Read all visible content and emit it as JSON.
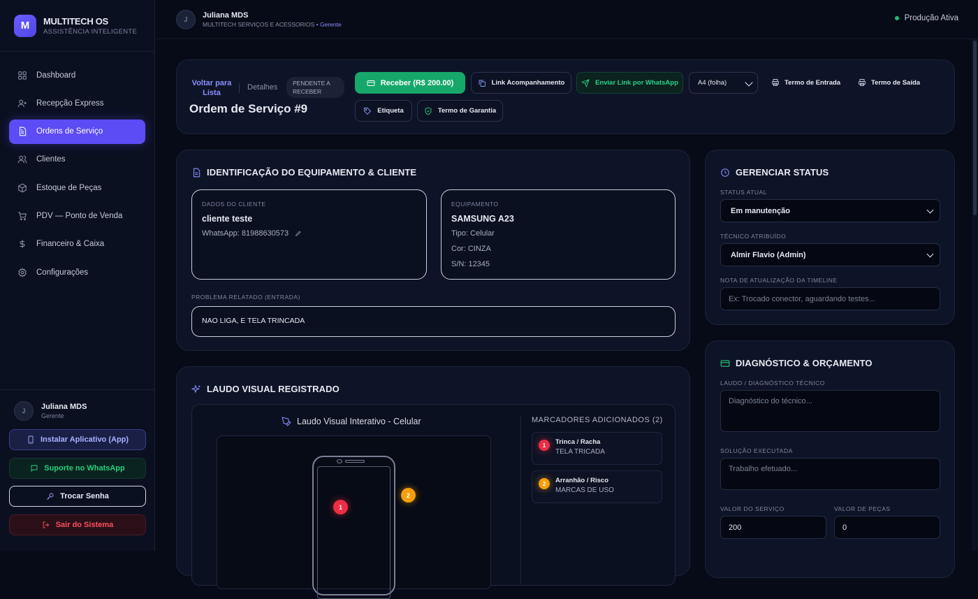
{
  "brand": {
    "title": "MULTITECH OS",
    "subtitle": "ASSISTÊNCIA INTELIGENTE",
    "logo_letter": "M"
  },
  "nav": {
    "items": [
      {
        "label": "Dashboard",
        "icon": "dashboard-icon"
      },
      {
        "label": "Recepção Express",
        "icon": "user-plus-icon"
      },
      {
        "label": "Ordens de Serviço",
        "icon": "document-icon",
        "active": true
      },
      {
        "label": "Clientes",
        "icon": "users-icon"
      },
      {
        "label": "Estoque de Peças",
        "icon": "box-icon"
      },
      {
        "label": "PDV — Ponto de Venda",
        "icon": "cart-icon"
      },
      {
        "label": "Financeiro & Caixa",
        "icon": "dollar-icon"
      },
      {
        "label": "Configurações",
        "icon": "gear-icon"
      }
    ]
  },
  "sidebar_user": {
    "initial": "J",
    "name": "Juliana MDS",
    "role": "Gerente"
  },
  "sidebar_buttons": {
    "install": "Instalar Aplicativo (App)",
    "support": "Suporte no WhatsApp",
    "password": "Trocar Senha",
    "logout": "Sair do Sistema"
  },
  "topbar": {
    "initial": "J",
    "name": "Juliana MDS",
    "company": "MULTITECH SERVIÇOS E ACESSORIOS",
    "bullet": "•",
    "role": "Gerente",
    "env_status": "Produção Ativa"
  },
  "header": {
    "back_label": "Voltar para Lista",
    "details_label": "Detalhes",
    "badge": "PENDENTE A RECEBER",
    "title": "Ordem de Serviço #9",
    "receive_button": "Receber (R$ 200.00)",
    "link_button": "Link Acompanhamento",
    "whatsapp_button": "Enviar Link por WhatsApp",
    "paper_format": "A4 (folha)",
    "entry_term": "Termo de Entrada",
    "exit_term": "Termo de Saída",
    "label_button": "Etiqueta",
    "warranty_button": "Termo de Garantia"
  },
  "identification": {
    "title": "IDENTIFICAÇÃO DO EQUIPAMENTO & CLIENTE",
    "client_label": "DADOS DO CLIENTE",
    "client_name": "cliente teste",
    "client_whatsapp": "WhatsApp: 81988630573",
    "equipment_label": "EQUIPAMENTO",
    "equipment_name": "SAMSUNG A23",
    "equipment_type": "Tipo: Celular",
    "equipment_color": "Cor: CINZA",
    "equipment_sn": "S/N: 12345",
    "problem_label": "PROBLEMA RELATADO (ENTRADA)",
    "problem_text": "NAO LIGA, E TELA TRINCADA"
  },
  "visual_report": {
    "title": "LAUDO VISUAL REGISTRADO",
    "interactive_title": "Laudo Visual Interativo - Celular",
    "markers_title": "MARCADORES ADICIONADOS (2)",
    "markers": [
      {
        "number": "1",
        "name": "Trinca / Racha",
        "desc": "TELA TRICADA",
        "color": "#ee2d44"
      },
      {
        "number": "2",
        "name": "Arranhão / Risco",
        "desc": "MARCAS DE USO",
        "color": "#f59e0b"
      }
    ]
  },
  "status_panel": {
    "title": "GERENCIAR STATUS",
    "current_label": "STATUS ATUAL",
    "current_value": "Em manutenção",
    "tech_label": "TÉCNICO ATRIBUÍDO",
    "tech_value": "Almir Flavio (Admin)",
    "note_label": "NOTA DE ATUALIZAÇÃO DA TIMELINE",
    "note_placeholder": "Ex: Trocado conector, aguardando testes..."
  },
  "diagnosis": {
    "title": "DIAGNÓSTICO & ORÇAMENTO",
    "report_label": "LAUDO / DIAGNÓSTICO TÉCNICO",
    "report_placeholder": "Diagnóstico do técnico...",
    "solution_label": "SOLUÇÃO EXECUTADA",
    "solution_placeholder": "Trabalho efetuado...",
    "service_value_label": "VALOR DO SERVIÇO",
    "service_value": "200",
    "parts_value_label": "VALOR DE PEÇAS",
    "parts_value": "0"
  },
  "colors": {
    "accent": "#5b4cf5",
    "success": "#15a86a",
    "whatsapp": "#25d07c",
    "danger": "#ff4f5e",
    "background": "#070b17"
  }
}
